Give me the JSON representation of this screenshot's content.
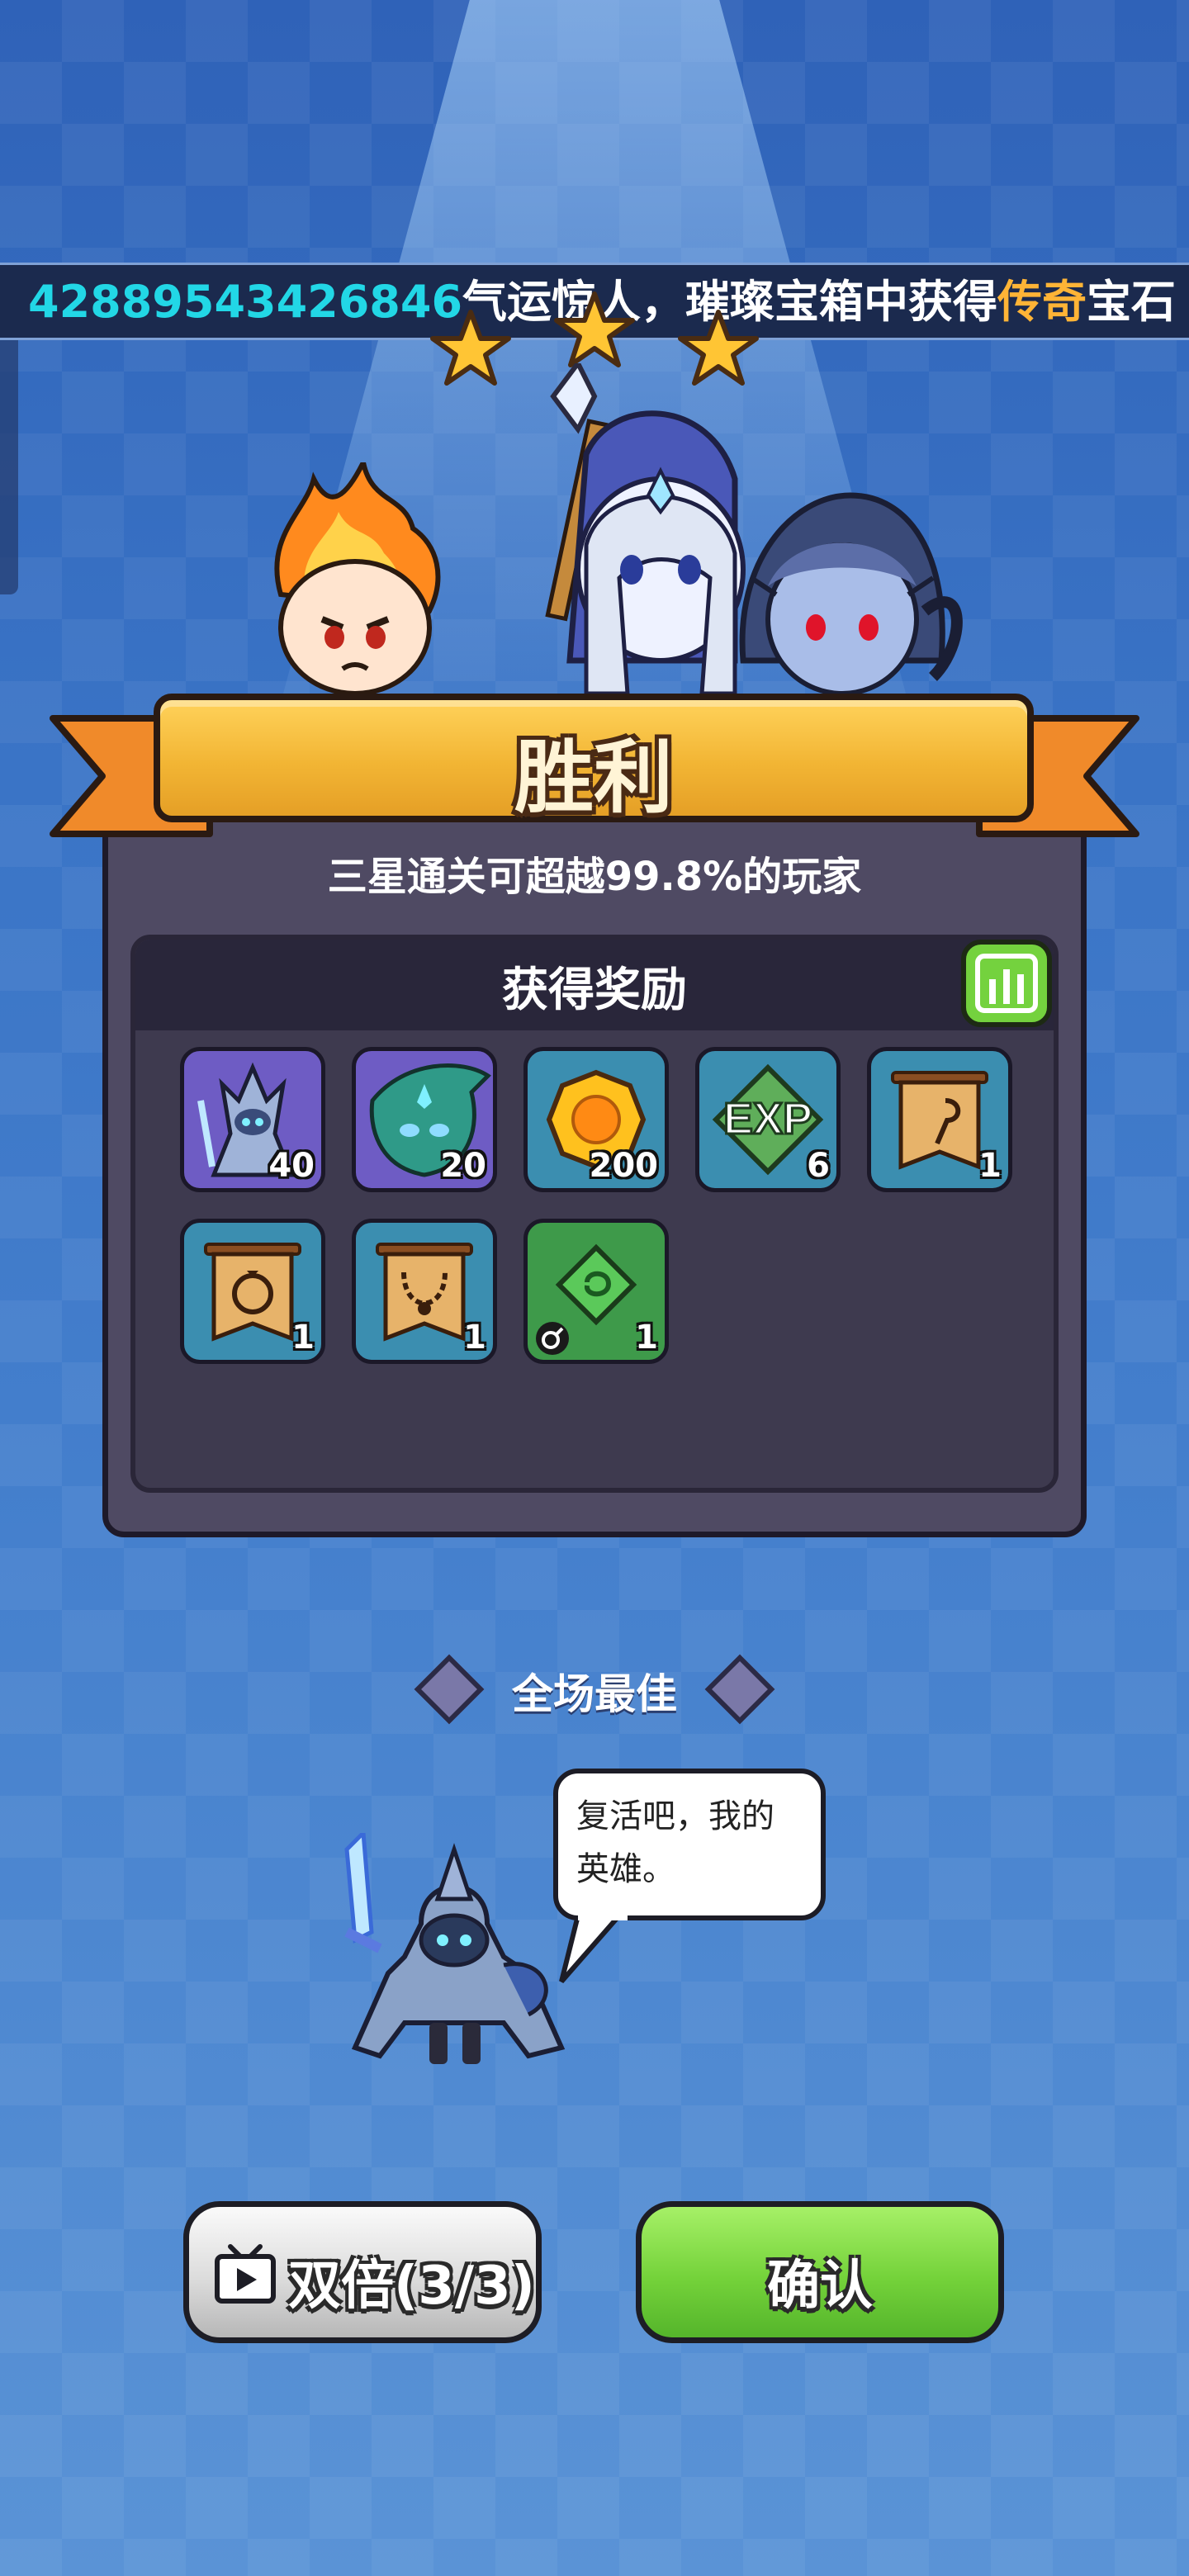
{
  "ticker": {
    "player_id": "42889543426846",
    "text_before": "气运惊人，璀璨宝箱中获得",
    "legend_word": "传奇",
    "text_after": "宝石"
  },
  "result": {
    "title": "胜利",
    "subtitle": "三星通关可超越99.8%的玩家",
    "stars": 3
  },
  "rewards": {
    "title": "获得奖励",
    "items": [
      {
        "icon": "knight-hero-shard-icon",
        "count": "40"
      },
      {
        "icon": "naga-hero-shard-icon",
        "count": "20"
      },
      {
        "icon": "gold-coin-icon",
        "count": "200"
      },
      {
        "icon": "exp-icon",
        "count": "6"
      },
      {
        "icon": "staff-scroll-icon",
        "count": "1"
      },
      {
        "icon": "ring-scroll-icon",
        "count": "1"
      },
      {
        "icon": "necklace-scroll-icon",
        "count": "1"
      },
      {
        "icon": "green-gem-icon",
        "count": "1"
      }
    ]
  },
  "mvp": {
    "label": "全场最佳",
    "quote": "复活吧，我的\n英雄。"
  },
  "buttons": {
    "double_label": "双倍(3/3)",
    "confirm_label": "确认"
  },
  "colors": {
    "accent_cyan": "#22d7e6",
    "legend_orange": "#ffb436",
    "banner_gold": "#f2b534",
    "confirm_green": "#74d23a"
  }
}
